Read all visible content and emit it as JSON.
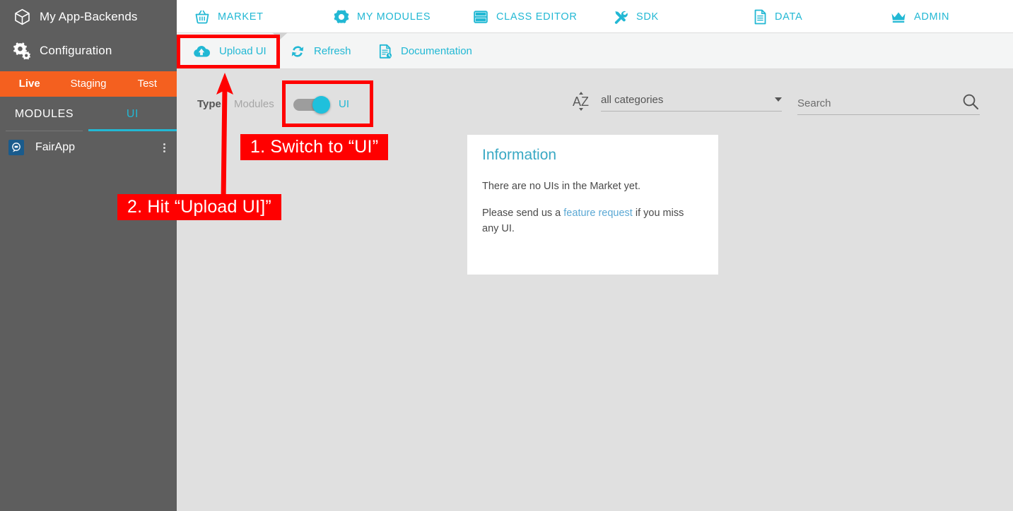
{
  "sidebar": {
    "top_items": [
      {
        "label": "My App-Backends",
        "icon": "cube-icon"
      },
      {
        "label": "Configuration",
        "icon": "gear-icon"
      }
    ],
    "env_tabs": [
      {
        "label": "Live",
        "active": true
      },
      {
        "label": "Staging",
        "active": false
      },
      {
        "label": "Test",
        "active": false
      }
    ],
    "module_tabs": [
      {
        "label": "MODULES",
        "selected": false
      },
      {
        "label": "UI",
        "selected": true
      }
    ],
    "apps": [
      {
        "name": "FairApp",
        "icon": "app-chat-icon",
        "menu_icon": "kebab-menu-icon"
      }
    ]
  },
  "topnav": {
    "items": [
      {
        "label": "MARKET",
        "icon": "basket-icon",
        "active": true
      },
      {
        "label": "MY MODULES",
        "icon": "gear-icon",
        "active": false
      },
      {
        "label": "CLASS EDITOR",
        "icon": "table-icon",
        "active": false
      },
      {
        "label": "SDK",
        "icon": "tools-icon",
        "active": false
      },
      {
        "label": "DATA",
        "icon": "document-icon",
        "active": false
      },
      {
        "label": "ADMIN",
        "icon": "crown-icon",
        "active": false
      }
    ]
  },
  "toolbar": {
    "items": [
      {
        "label": "Upload UI",
        "icon": "cloud-upload-icon"
      },
      {
        "label": "Refresh",
        "icon": "refresh-icon"
      },
      {
        "label": "Documentation",
        "icon": "document-clock-icon"
      }
    ]
  },
  "filters": {
    "type_label": "Type",
    "modules_label": "Modules",
    "ui_label": "UI",
    "toggle_state": "UI",
    "sort_icon": "sort-az-icon",
    "category_value": "all categories",
    "category_caret": "chevron-down-icon",
    "search_placeholder": "Search",
    "search_value": "",
    "search_icon": "search-icon"
  },
  "information": {
    "title": "Information",
    "line1": "There are no UIs in the Market yet.",
    "line2_before": "Please send us a ",
    "line2_link": "feature request",
    "line2_after": " if you miss any UI."
  },
  "annotations": {
    "callout_1": "1. Switch to “UI”",
    "callout_2": "2. Hit “Upload UI]”",
    "highlight_color": "#ff0000"
  },
  "colors": {
    "accent_cyan": "#22b8d4",
    "sidebar_bg": "#5e5e5e",
    "env_orange": "#f4601f",
    "page_bg": "#e0e0e0",
    "toolbar_bg": "#f4f5f5",
    "annotation_red": "#ff0000"
  }
}
